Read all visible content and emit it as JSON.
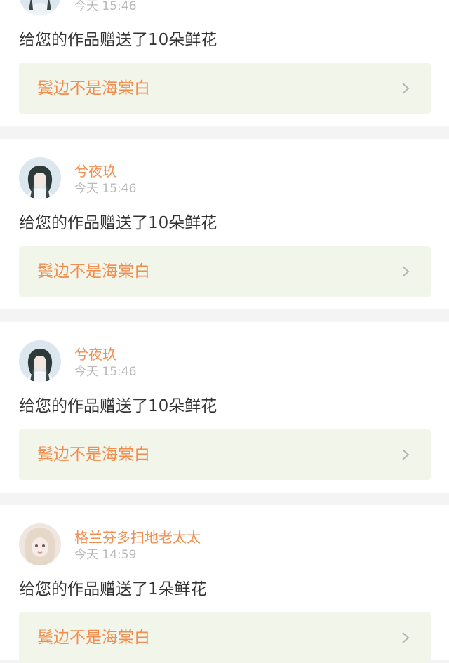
{
  "notifications": [
    {
      "user_name": "",
      "time": "今天 15:46",
      "message": "给您的作品赠送了10朵鲜花",
      "work_title": "鬓边不是海棠白",
      "avatar": "girl-avatar-icon"
    },
    {
      "user_name": "兮夜玖",
      "time": "今天 15:46",
      "message": "给您的作品赠送了10朵鲜花",
      "work_title": "鬓边不是海棠白",
      "avatar": "girl-avatar-icon"
    },
    {
      "user_name": "兮夜玖",
      "time": "今天 15:46",
      "message": "给您的作品赠送了10朵鲜花",
      "work_title": "鬓边不是海棠白",
      "avatar": "girl-avatar-icon"
    },
    {
      "user_name": "格兰芬多扫地老太太",
      "time": "今天 14:59",
      "message": "给您的作品赠送了1朵鲜花",
      "work_title": "鬓边不是海棠白",
      "avatar": "doll-avatar-icon"
    }
  ],
  "icons": {
    "chevron": "chevron-right-icon"
  },
  "colors": {
    "accent": "#f28d4e",
    "link_bg": "#f2f5ea",
    "time": "#b9b9b9",
    "text": "#333333",
    "divider": "#f4f4f4"
  }
}
